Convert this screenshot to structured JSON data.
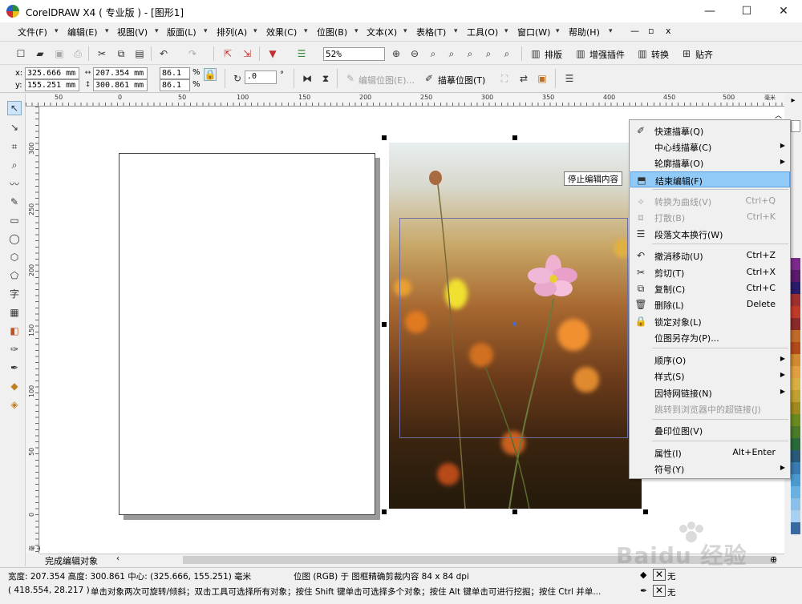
{
  "window": {
    "title": "CorelDRAW X4 ( 专业版 ) - [图形1]",
    "controls": {
      "minimize": "—",
      "maximize": "☐",
      "close": "✕"
    }
  },
  "menubar": {
    "items": [
      "文件(F)",
      "编辑(E)",
      "视图(V)",
      "版面(L)",
      "排列(A)",
      "效果(C)",
      "位图(B)",
      "文本(X)",
      "表格(T)",
      "工具(O)",
      "窗口(W)",
      "帮助(H)"
    ],
    "doc_controls": [
      "—",
      "▫",
      "x"
    ]
  },
  "toolbar_standard": {
    "zoom_value": "52%",
    "buttons": [
      "排版",
      "增强插件",
      "转换",
      "贴齐"
    ]
  },
  "property_bar": {
    "x_label": "x:",
    "x_value": "325.666 mm",
    "y_label": "y:",
    "y_value": "155.251 mm",
    "w_value": "207.354 mm",
    "h_value": "300.861 mm",
    "scale_x": "86.1",
    "scale_y": "86.1",
    "percent": "%",
    "rotation": ".0",
    "degree": "°",
    "edit_bitmap_label": "编辑位图(E)...",
    "trace_bitmap_label": "描摹位图(T)"
  },
  "ruler": {
    "h_labels": [
      "50",
      "0",
      "50",
      "100",
      "150",
      "200",
      "250",
      "300",
      "350",
      "400",
      "450",
      "500"
    ],
    "h_unit": "毫米",
    "v_labels": [
      "300",
      "250",
      "200",
      "150",
      "100",
      "50",
      "0"
    ],
    "v_unit": "毫米"
  },
  "page_tab": {
    "label": "完成编辑对象"
  },
  "tooltip": {
    "text": "停止编辑内容"
  },
  "context_menu": {
    "items": [
      {
        "label": "快速描摹(Q)",
        "shortcut": "",
        "submenu": false,
        "disabled": false,
        "icon": "quick-trace-icon"
      },
      {
        "label": "中心线描摹(C)",
        "shortcut": "",
        "submenu": true,
        "disabled": false,
        "icon": ""
      },
      {
        "label": "轮廓描摹(O)",
        "shortcut": "",
        "submenu": true,
        "disabled": false,
        "icon": ""
      },
      {
        "label": "结束编辑(F)",
        "shortcut": "",
        "submenu": false,
        "disabled": false,
        "icon": "finish-edit-icon",
        "highlight": true
      },
      {
        "label": "转换为曲线(V)",
        "shortcut": "Ctrl+Q",
        "submenu": false,
        "disabled": true,
        "icon": "convert-curve-icon"
      },
      {
        "label": "打散(B)",
        "shortcut": "Ctrl+K",
        "submenu": false,
        "disabled": true,
        "icon": "break-apart-icon"
      },
      {
        "label": "段落文本换行(W)",
        "shortcut": "",
        "submenu": false,
        "disabled": false,
        "icon": "text-wrap-icon"
      },
      {
        "label": "撤消移动(U)",
        "shortcut": "Ctrl+Z",
        "submenu": false,
        "disabled": false,
        "icon": "undo-icon"
      },
      {
        "label": "剪切(T)",
        "shortcut": "Ctrl+X",
        "submenu": false,
        "disabled": false,
        "icon": "cut-icon"
      },
      {
        "label": "复制(C)",
        "shortcut": "Ctrl+C",
        "submenu": false,
        "disabled": false,
        "icon": "copy-icon"
      },
      {
        "label": "删除(L)",
        "shortcut": "Delete",
        "submenu": false,
        "disabled": false,
        "icon": "delete-icon"
      },
      {
        "label": "锁定对象(L)",
        "shortcut": "",
        "submenu": false,
        "disabled": false,
        "icon": "lock-icon"
      },
      {
        "label": "位图另存为(P)...",
        "shortcut": "",
        "submenu": false,
        "disabled": false,
        "icon": ""
      },
      {
        "label": "顺序(O)",
        "shortcut": "",
        "submenu": true,
        "disabled": false,
        "icon": ""
      },
      {
        "label": "样式(S)",
        "shortcut": "",
        "submenu": true,
        "disabled": false,
        "icon": ""
      },
      {
        "label": "因特网链接(N)",
        "shortcut": "",
        "submenu": true,
        "disabled": false,
        "icon": ""
      },
      {
        "label": "跳转到浏览器中的超链接(J)",
        "shortcut": "",
        "submenu": false,
        "disabled": true,
        "icon": ""
      },
      {
        "label": "叠印位图(V)",
        "shortcut": "",
        "submenu": false,
        "disabled": false,
        "icon": ""
      },
      {
        "label": "属性(I)",
        "shortcut": "Alt+Enter",
        "submenu": false,
        "disabled": false,
        "icon": ""
      },
      {
        "label": "符号(Y)",
        "shortcut": "",
        "submenu": true,
        "disabled": false,
        "icon": ""
      }
    ]
  },
  "status": {
    "line1_left": "宽度: 207.354  高度: 300.861  中心: (325.666, 155.251)  毫米",
    "line1_right": "位图 (RGB) 于 图框精确剪裁内容 84 x 84 dpi",
    "line2_coords": "( 418.554, 28.217 )",
    "line2_hint": "单击对象两次可旋转/倾斜；双击工具可选择所有对象；按住 Shift 键单击可选择多个对象；按住 Alt 键单击可进行挖掘；按住 Ctrl 并单...",
    "fill_none": "无",
    "outline_none": "无"
  },
  "watermark": {
    "text": "Baidu 经验"
  },
  "colors": {
    "accent_highlight": "#91c9f7",
    "frame_outline": "#6f6fa0"
  }
}
